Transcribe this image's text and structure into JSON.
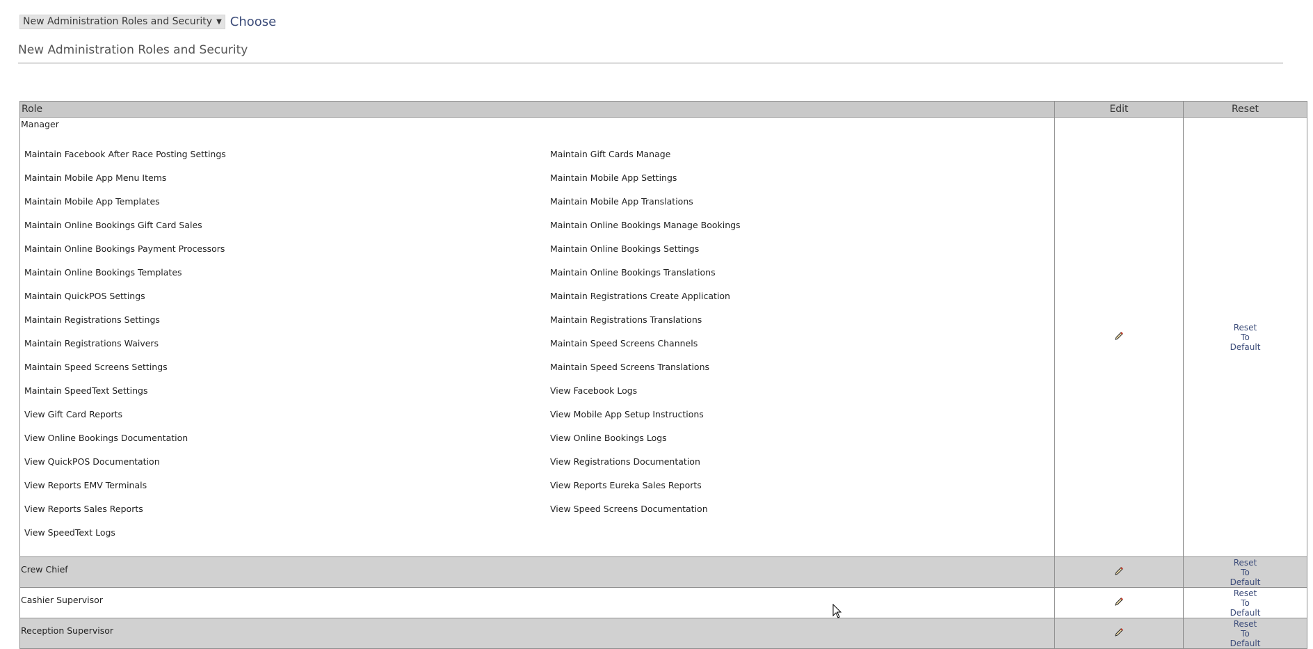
{
  "toolbar": {
    "selected_option": "New Administration Roles and Security",
    "choose_label": "Choose"
  },
  "page_title": "New Administration Roles and Security",
  "table": {
    "headers": {
      "role": "Role",
      "edit": "Edit",
      "reset": "Reset"
    },
    "reset_label": [
      "Reset",
      "To",
      "Default"
    ],
    "manager": {
      "name": "Manager",
      "permissions": [
        "Maintain Facebook After Race Posting Settings",
        "Maintain Gift Cards Manage",
        "Maintain Mobile App Menu Items",
        "Maintain Mobile App Settings",
        "Maintain Mobile App Templates",
        "Maintain Mobile App Translations",
        "Maintain Online Bookings Gift Card Sales",
        "Maintain Online Bookings Manage Bookings",
        "Maintain Online Bookings Payment Processors",
        "Maintain Online Bookings Settings",
        "Maintain Online Bookings Templates",
        "Maintain Online Bookings Translations",
        "Maintain QuickPOS Settings",
        "Maintain Registrations Create Application",
        "Maintain Registrations Settings",
        "Maintain Registrations Translations",
        "Maintain Registrations Waivers",
        "Maintain Speed Screens Channels",
        "Maintain Speed Screens Settings",
        "Maintain Speed Screens Translations",
        "Maintain SpeedText Settings",
        "View Facebook Logs",
        "View Gift Card Reports",
        "View Mobile App Setup Instructions",
        "View Online Bookings Documentation",
        "View Online Bookings Logs",
        "View QuickPOS Documentation",
        "View Registrations Documentation",
        "View Reports EMV Terminals",
        "View Reports Eureka Sales Reports",
        "View Reports Sales Reports",
        "View Speed Screens Documentation",
        "View SpeedText Logs"
      ]
    },
    "other_roles": [
      "Crew Chief",
      "Cashier Supervisor",
      "Reception Supervisor"
    ]
  }
}
